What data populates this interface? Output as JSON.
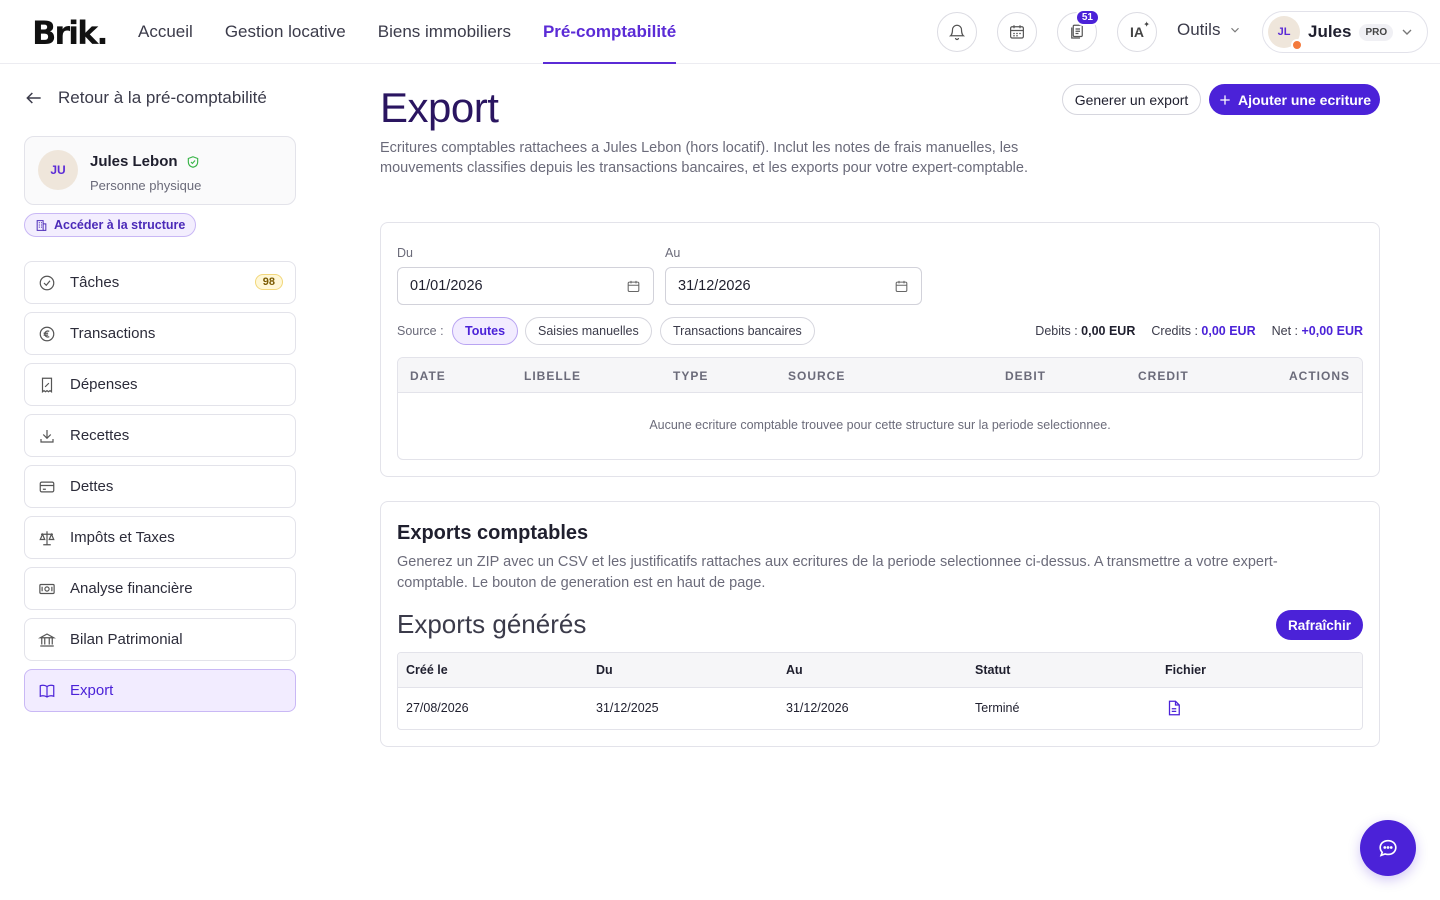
{
  "app": {
    "logo": "Brik."
  },
  "nav": {
    "items": [
      {
        "label": "Accueil"
      },
      {
        "label": "Gestion locative"
      },
      {
        "label": "Biens immobiliers"
      },
      {
        "label": "Pré-comptabilité"
      }
    ],
    "active_index": 3
  },
  "topbar": {
    "documents_badge": "51",
    "ia_label": "IA",
    "tools_label": "Outils",
    "user": {
      "initials": "JL",
      "name": "Jules",
      "badge": "PRO"
    }
  },
  "sidebar": {
    "back_label": "Retour à la pré-comptabilité",
    "profile": {
      "initials": "JU",
      "name": "Jules Lebon",
      "type": "Personne physique"
    },
    "structure_link": "Accéder à la structure",
    "items": [
      {
        "label": "Tâches",
        "icon": "check-circle-icon",
        "count": "98"
      },
      {
        "label": "Transactions",
        "icon": "euro-icon"
      },
      {
        "label": "Dépenses",
        "icon": "receipt-icon"
      },
      {
        "label": "Recettes",
        "icon": "download-icon"
      },
      {
        "label": "Dettes",
        "icon": "credit-card-icon"
      },
      {
        "label": "Impôts et Taxes",
        "icon": "scale-icon"
      },
      {
        "label": "Analyse financière",
        "icon": "money-icon"
      },
      {
        "label": "Bilan Patrimonial",
        "icon": "bank-icon"
      },
      {
        "label": "Export",
        "icon": "book-icon"
      }
    ],
    "active_index": 8
  },
  "main": {
    "title": "Export",
    "description": "Ecritures comptables rattachees a Jules Lebon (hors locatif). Inclut les notes de frais manuelles, les mouvements classifies depuis les transactions bancaires, et les exports pour votre expert-comptable.",
    "generate_button": "Generer un export",
    "add_button": "Ajouter une ecriture",
    "filters": {
      "from_label": "Du",
      "from_value": "01/01/2026",
      "to_label": "Au",
      "to_value": "31/12/2026",
      "source_label": "Source :",
      "sources": [
        "Toutes",
        "Saisies manuelles",
        "Transactions bancaires"
      ],
      "active_source": 0
    },
    "totals": {
      "debits_label": "Debits :",
      "debits_value": "0,00 EUR",
      "credits_label": "Credits :",
      "credits_value": "0,00 EUR",
      "net_label": "Net :",
      "net_value": "+0,00 EUR"
    },
    "ledger": {
      "columns": [
        "DATE",
        "LIBELLE",
        "TYPE",
        "SOURCE",
        "DEBIT",
        "CREDIT",
        "ACTIONS"
      ],
      "empty_message": "Aucune ecriture comptable trouvee pour cette structure sur la periode selectionnee."
    },
    "exports": {
      "title": "Exports comptables",
      "description": "Generez un ZIP avec un CSV et les justificatifs rattaches aux ecritures de la periode selectionnee ci-dessus. A transmettre a votre expert-comptable. Le bouton de generation est en haut de page.",
      "generated_title": "Exports générés",
      "refresh_button": "Rafraîchir",
      "columns": [
        "Créé le",
        "Du",
        "Au",
        "Statut",
        "Fichier"
      ],
      "rows": [
        {
          "created": "27/08/2026",
          "from": "31/12/2025",
          "to": "31/12/2026",
          "status": "Terminé",
          "file_icon": "file-icon"
        }
      ]
    }
  },
  "colors": {
    "accent": "#4b22d8",
    "nav_active": "#5b2bd6",
    "title": "#2a1560"
  }
}
